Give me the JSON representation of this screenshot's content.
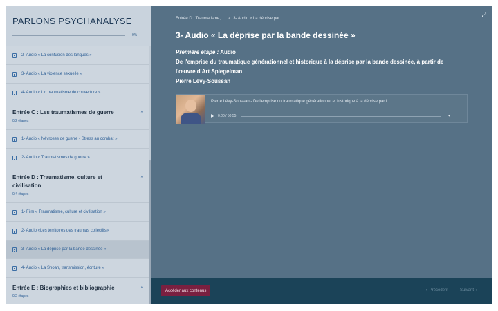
{
  "sidebar": {
    "title": "PARLONS PSYCHANALYSE",
    "progress_label": "0%",
    "progress_value": 0,
    "items": [
      {
        "kind": "lesson",
        "label": "2- Audio « La confusion des langues »"
      },
      {
        "kind": "lesson",
        "label": "3- Audio « La violence sexuelle »"
      },
      {
        "kind": "lesson",
        "label": "4- Audio « Un traumatisme de couverture »"
      },
      {
        "kind": "section",
        "title": "Entrée C : Les traumatismes de guerre",
        "steps": "0/2 étapes"
      },
      {
        "kind": "lesson",
        "label": "1- Audio « Névroses de guerre - Stress au combat »"
      },
      {
        "kind": "lesson",
        "label": "2- Audio « Traumatismes de guerre »"
      },
      {
        "kind": "section",
        "title": "Entrée D : Traumatisme, culture et civilisation",
        "steps": "0/4 étapes"
      },
      {
        "kind": "lesson",
        "label": "1- Film « Traumatisme, culture et civilisation »"
      },
      {
        "kind": "lesson",
        "label": "2- Audio «Les territoires des traumas collectifs»"
      },
      {
        "kind": "lesson",
        "label": "3- Audio « La déprise par la bande dessinée »",
        "active": true
      },
      {
        "kind": "lesson",
        "label": "4- Audio « La Shoah, transmission, écriture »"
      },
      {
        "kind": "section",
        "title": "Entrée E : Biographies et bibliographie",
        "steps": "0/2 étapes"
      }
    ]
  },
  "breadcrumb": {
    "part1": "Entrée D : Traumatisme, ...",
    "separator": ">",
    "part2": "3- Audio « La déprise par ..."
  },
  "main": {
    "title": "3- Audio « La déprise par la bande dessinée »",
    "step_label": "Première étape :",
    "step_type": " Audio",
    "description": "De l'emprise du traumatique générationnel et historique à la déprise par la bande dessinée, à partir de l'œuvre d'Art Spiegelman",
    "author": "Pierre Lévy-Soussan"
  },
  "player": {
    "track_title": "Pierre Lévy-Soussan - De l'emprise du traumatique générationnel et historique à la déprise par l...",
    "time": "0:00 / 50:55"
  },
  "footer": {
    "access_label": "Accéder aux contenus",
    "prev_label": "Précédent",
    "next_label": "Suivant"
  }
}
